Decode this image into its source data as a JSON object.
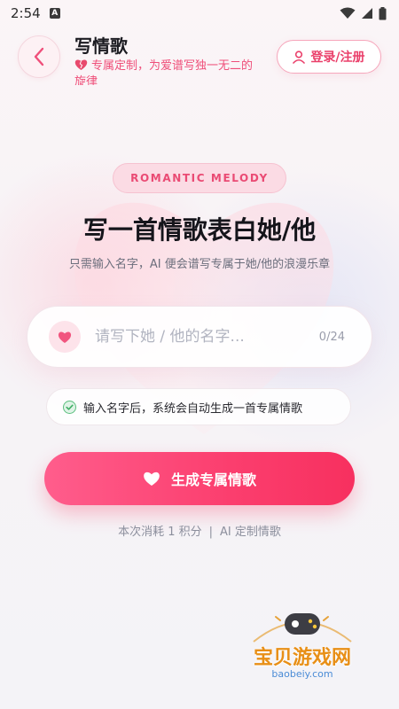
{
  "status_bar": {
    "time": "2:54",
    "badge": "A"
  },
  "header": {
    "title": "写情歌",
    "subtitle": "专属定制，为爱谱写独一无二的旋律",
    "login_label": "登录/注册"
  },
  "hero": {
    "tag": "ROMANTIC MELODY",
    "title": "写一首情歌表白她/他",
    "description": "只需输入名字，AI 便会谱写专属于她/他的浪漫乐章"
  },
  "name_input": {
    "value": "",
    "placeholder": "请写下她 / 他的名字...",
    "counter": "0/24"
  },
  "hint": {
    "text": "输入名字后，系统会自动生成一首专属情歌"
  },
  "generate": {
    "label": "生成专属情歌"
  },
  "cost": {
    "left": "本次消耗 1 积分",
    "separator": "|",
    "right": "AI 定制情歌"
  },
  "watermark": {
    "text": "宝贝游戏网",
    "url": "baobeiy.com"
  },
  "colors": {
    "accent": "#f7305f",
    "accent_light": "#ff5d8c",
    "tag_bg": "#fbdbe4"
  }
}
